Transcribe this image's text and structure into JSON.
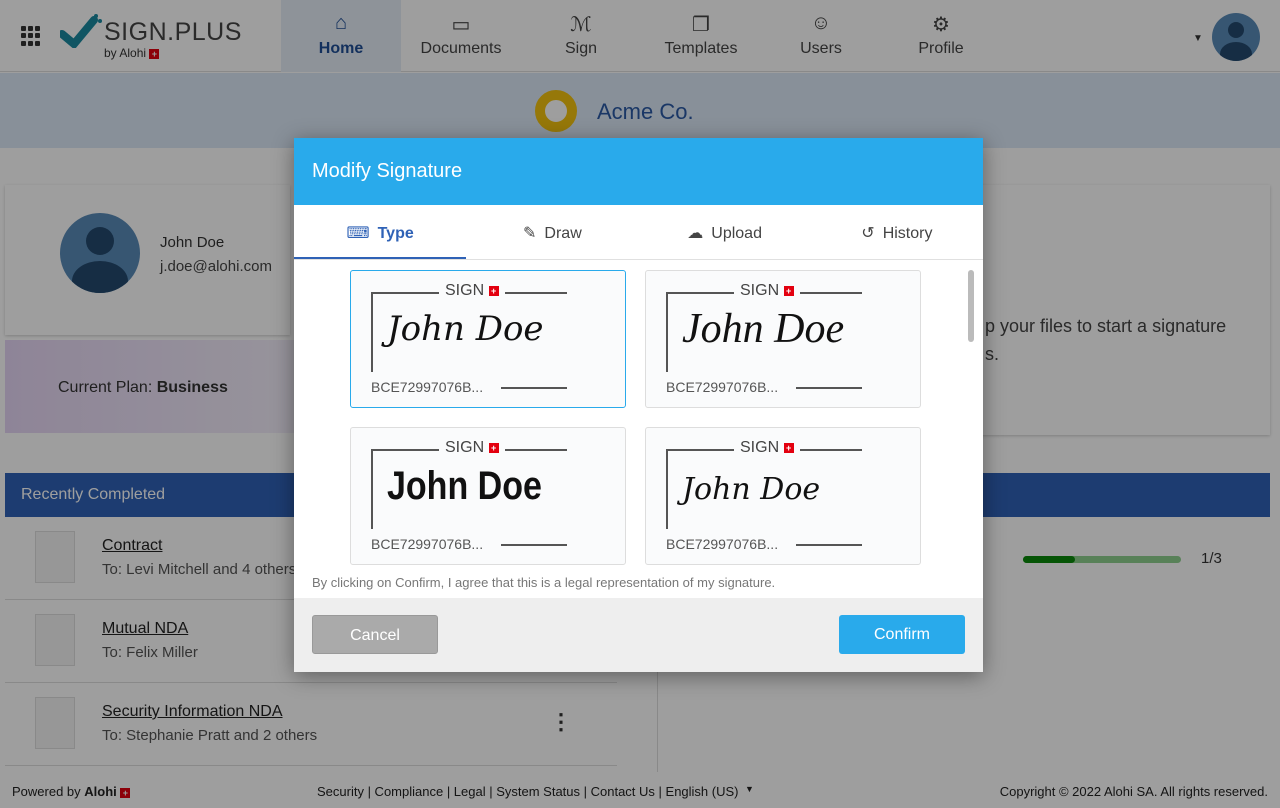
{
  "header": {
    "logo": "SIGN.PLUS",
    "logo_sub": "by Alohi",
    "nav": [
      {
        "label": "Home",
        "icon": "home-icon"
      },
      {
        "label": "Documents",
        "icon": "inbox-icon"
      },
      {
        "label": "Sign",
        "icon": "signature-icon"
      },
      {
        "label": "Templates",
        "icon": "copy-icon"
      },
      {
        "label": "Users",
        "icon": "users-icon"
      },
      {
        "label": "Profile",
        "icon": "user-gear-icon"
      }
    ]
  },
  "company": {
    "name": "Acme Co."
  },
  "profile": {
    "name": "John Doe",
    "email": "j.doe@alohi.com"
  },
  "plan": {
    "label": "Current Plan: ",
    "value": "Business"
  },
  "recent": {
    "title": "Recently Completed",
    "items": [
      {
        "title": "Contract",
        "to": "To: Levi Mitchell and 4 others"
      },
      {
        "title": "Mutual NDA",
        "to": "To: Felix Miller"
      },
      {
        "title": "Security Information NDA",
        "to": "To: Stephanie Pratt and 2 others"
      }
    ]
  },
  "right": {
    "drop_text_1": "p your files to start a signature",
    "drop_text_2": "s.",
    "progress": "1/3",
    "progress_fraction": 0.33
  },
  "modal": {
    "title": "Modify Signature",
    "tabs": [
      {
        "label": "Type",
        "icon": "keyboard-icon"
      },
      {
        "label": "Draw",
        "icon": "draw-icon"
      },
      {
        "label": "Upload",
        "icon": "cloud-upload-icon"
      },
      {
        "label": "History",
        "icon": "history-icon"
      }
    ],
    "signatures": [
      {
        "brand": "SIGN",
        "name": "John Doe",
        "id": "BCE72997076B..."
      },
      {
        "brand": "SIGN",
        "name": "John Doe",
        "id": "BCE72997076B..."
      },
      {
        "brand": "SIGN",
        "name": "John Doe",
        "id": "BCE72997076B..."
      },
      {
        "brand": "SIGN",
        "name": "John Doe",
        "id": "BCE72997076B..."
      }
    ],
    "disclaimer": "By clicking on Confirm, I agree that this is a legal representation of my signature.",
    "cancel": "Cancel",
    "confirm": "Confirm"
  },
  "footer": {
    "powered": "Powered by ",
    "brand": "Alohi",
    "links": "Security | Compliance | Legal | System Status | Contact Us | English (US)",
    "copyright": "Copyright © 2022 Alohi SA. All rights reserved."
  }
}
